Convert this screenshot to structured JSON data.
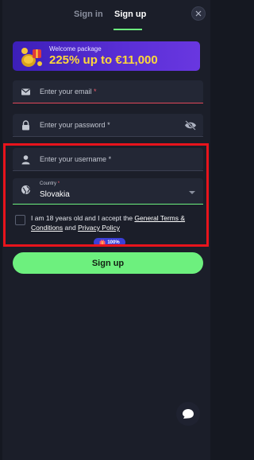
{
  "tabs": {
    "signin": "Sign in",
    "signup": "Sign up"
  },
  "banner": {
    "small": "Welcome package",
    "big": "225% up to €11,000"
  },
  "fields": {
    "email_placeholder": "Enter your email",
    "password_placeholder": "Enter your password",
    "username_placeholder": "Enter your username",
    "required_mark": "*",
    "country_label": "Country",
    "country_value": "Slovakia"
  },
  "terms": {
    "prefix": "I am 18 years old and I accept the ",
    "link1": "General Terms & Conditions",
    "middle": " and ",
    "link2": "Privacy Policy"
  },
  "badge": "100%",
  "signup_button": "Sign up",
  "colors": {
    "accent": "#6df07e",
    "error": "#e2495a",
    "highlight": "#e8141c",
    "banner_text": "#ffd83a"
  }
}
